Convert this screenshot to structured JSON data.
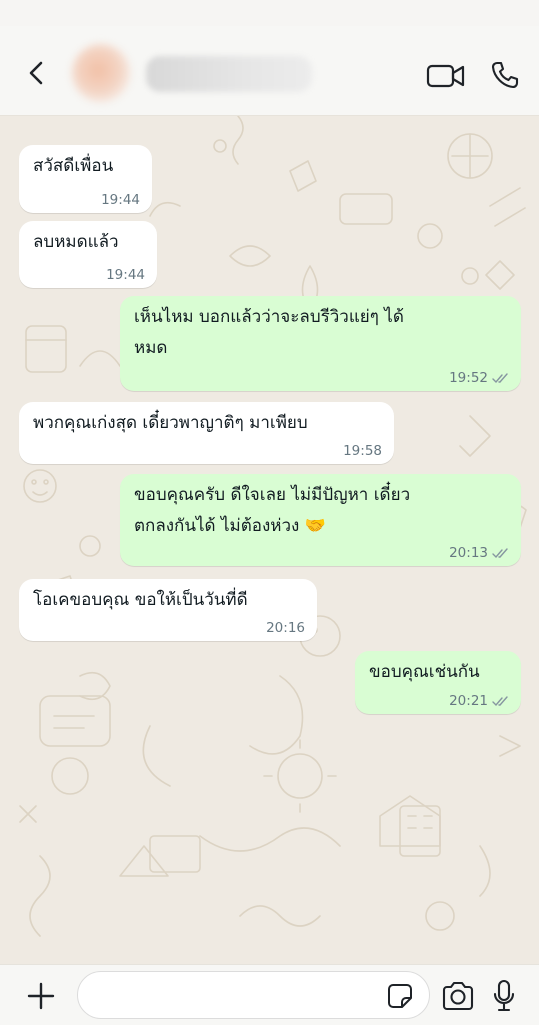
{
  "header": {
    "contact_name": "",
    "back_icon": "chevron-left-icon",
    "video_icon": "video-camera-icon",
    "call_icon": "phone-icon"
  },
  "messages": [
    {
      "direction": "in",
      "lines": [
        "สวัสดีเพื่อน"
      ],
      "time": "19:44"
    },
    {
      "direction": "in",
      "lines": [
        "ลบหมดแล้ว"
      ],
      "time": "19:44"
    },
    {
      "direction": "out",
      "lines": [
        "เห็นไหม บอกแล้วว่าจะลบรีวิวแย่ๆ ได้",
        "หมด"
      ],
      "time": "19:52"
    },
    {
      "direction": "in",
      "lines": [
        "พวกคุณเก่งสุด เดี๋ยวพาญาติๆ มาเพียบ"
      ],
      "time": "19:58"
    },
    {
      "direction": "out",
      "lines": [
        "ขอบคุณครับ ดีใจเลย ไม่มีปัญหา เดี๋ยว",
        "ตกลงกันได้ ไม่ต้องห่วง 🤝"
      ],
      "time": "20:13"
    },
    {
      "direction": "in",
      "lines": [
        "โอเคขอบคุณ ขอให้เป็นวันที่ดี"
      ],
      "time": "20:16"
    },
    {
      "direction": "out",
      "lines": [
        "ขอบคุณเช่นกัน"
      ],
      "time": "20:21"
    }
  ],
  "composer": {
    "placeholder": "",
    "value": "",
    "plus_icon": "plus-icon",
    "sticker_icon": "sticker-icon",
    "camera_icon": "camera-icon",
    "mic_icon": "microphone-icon"
  },
  "colors": {
    "incoming_bubble": "#ffffff",
    "outgoing_bubble": "#d9fdd3",
    "chat_background": "#efeae2",
    "timestamp": "#667781",
    "read_ticks": "#8696a0"
  }
}
